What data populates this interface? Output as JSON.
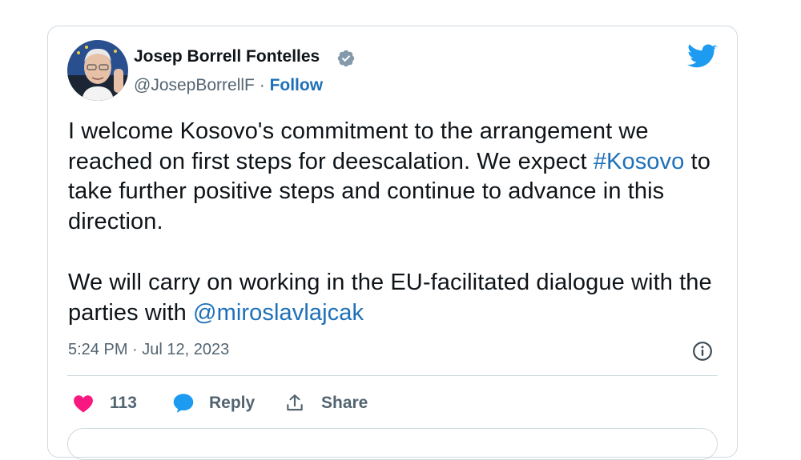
{
  "tweet": {
    "author": {
      "name": "Josep Borrell Fontelles",
      "handle": "@JosepBorrellF",
      "separator": "·",
      "follow_label": "Follow",
      "verified": true
    },
    "paragraphs": [
      {
        "text_before": "I welcome Kosovo's commitment to the arrangement we reached on first steps for deescalation. We expect ",
        "hashtag": "#Kosovo",
        "text_after": " to take further positive steps and continue to advance in this direction."
      },
      {
        "text_before": "We will carry on working in the EU-facilitated dialogue with the parties with ",
        "mention": "@miroslavlajcak"
      }
    ],
    "timestamp": "5:24 PM · Jul 12, 2023",
    "actions": {
      "like_count": "113",
      "reply_label": "Reply",
      "share_label": "Share"
    }
  },
  "colors": {
    "brand": "#1d9bf0",
    "link": "#1d70b8",
    "like": "#f91880",
    "muted": "#536471",
    "border": "#cfd9de"
  },
  "icons": [
    "verified-badge-icon",
    "twitter-bird-icon",
    "info-icon",
    "heart-icon",
    "reply-bubble-icon",
    "share-icon"
  ]
}
